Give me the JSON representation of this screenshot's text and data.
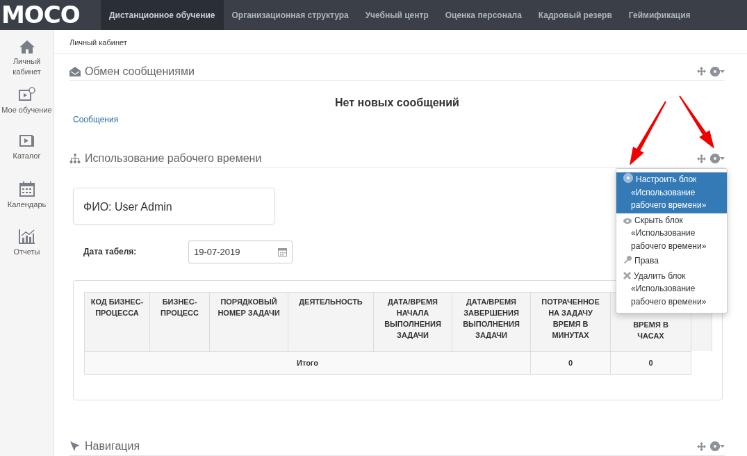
{
  "navbar": {
    "logo": "MOCO",
    "items": [
      {
        "label": "Дистанционное обучение",
        "selected": true
      },
      {
        "label": "Организационная структура",
        "selected": false
      },
      {
        "label": "Учебный центр",
        "selected": false
      },
      {
        "label": "Оценка персонала",
        "selected": false
      },
      {
        "label": "Кадровый резерв",
        "selected": false
      },
      {
        "label": "Геймификация",
        "selected": false
      }
    ]
  },
  "sidebar": {
    "items": [
      {
        "label": "Личный кабинет"
      },
      {
        "label": "Мое обучение"
      },
      {
        "label": "Каталог"
      },
      {
        "label": "Календарь"
      },
      {
        "label": "Отчеты"
      }
    ]
  },
  "breadcrumb": "Личный кабинет",
  "blocks": [
    {
      "kind": "messages",
      "title": "Обмен сообщениями",
      "notice": "Нет новых сообщений",
      "link": "Сообщения"
    },
    {
      "kind": "worktime",
      "title": "Использование рабочего времени",
      "fio": "ФИО: User Admin",
      "date_label": "Дата табеля:",
      "date_value": "19-07-2019",
      "table": {
        "columns": [
          {
            "label": "КОД БИЗНЕС-ПРОЦЕССА"
          },
          {
            "label": "БИЗНЕС-ПРОЦЕСС"
          },
          {
            "label": "ПОРЯДКОВЫЙ НОМЕР ЗАДАЧИ"
          },
          {
            "label": "ДЕЯТЕЛЬНОСТЬ"
          },
          {
            "label": "ДАТА/ВРЕМЯ НАЧАЛА ВЫПОЛНЕНИЯ ЗАДАЧИ"
          },
          {
            "label": "ДАТА/ВРЕМЯ ЗАВЕРШЕНИЯ ВЫПОЛНЕНИЯ ЗАДАЧИ"
          },
          {
            "label": "ПОТРАЧЕННОЕ НА ЗАДАЧУ ВРЕМЯ В МИНУТАХ"
          },
          {
            "label": "ВРЕМЯ В ЧАСАХ",
            "kind": "partial"
          }
        ],
        "total_label": "Итого",
        "totals": [
          "0",
          "0"
        ]
      },
      "menu": {
        "items": [
          {
            "label": "Настроить блок «Использование рабочего времени»",
            "selected": true
          },
          {
            "label": "Скрыть блок «Использование рабочего времени»",
            "selected": false
          },
          {
            "label": "Права",
            "selected": false
          },
          {
            "label": "Удалить блок «Использование рабочего времени»",
            "selected": false
          }
        ]
      }
    },
    {
      "kind": "nav",
      "title": "Навигация"
    }
  ]
}
